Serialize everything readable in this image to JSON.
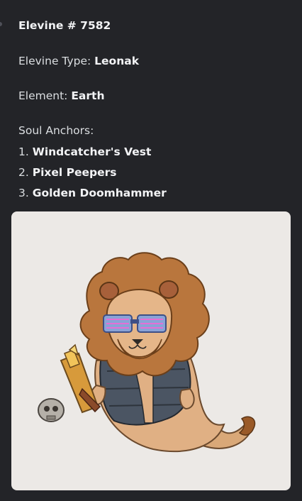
{
  "nft": {
    "title": "Elevine # 7582",
    "type_label": "Elevine Type:",
    "type_value": "Leonak",
    "element_label": "Element:",
    "element_value": "Earth",
    "anchors_label": "Soul Anchors:",
    "anchors": [
      {
        "num": "1.",
        "name": "Windcatcher's Vest"
      },
      {
        "num": "2.",
        "name": "Pixel Peepers"
      },
      {
        "num": "3.",
        "name": "Golden Doomhammer"
      }
    ]
  },
  "image": {
    "subject": "lion-ghost-character-with-shutter-shades-vest-and-hammer",
    "background_color": "#ece9e6"
  },
  "colors": {
    "page_background": "#232428",
    "text": "#dbdee1",
    "bold_text": "#f2f3f5"
  }
}
